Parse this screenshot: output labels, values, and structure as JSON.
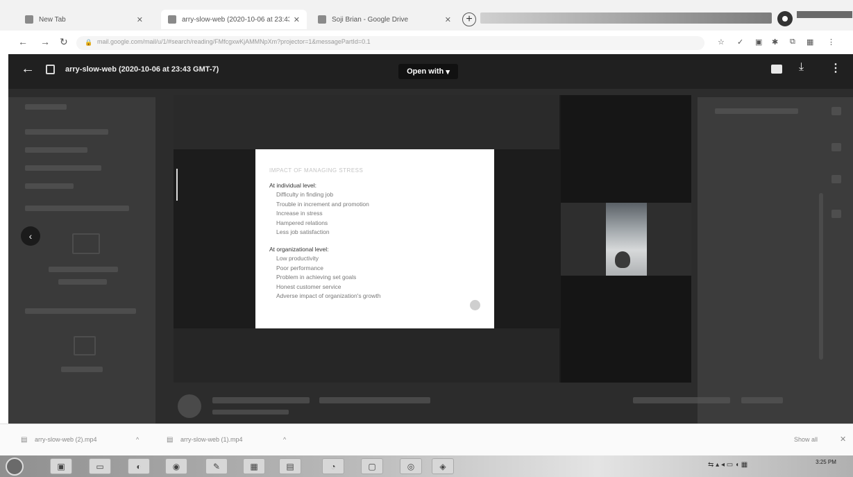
{
  "browser": {
    "tabs": [
      {
        "label": "New Tab",
        "active": false
      },
      {
        "label": "arry-slow-web (2020-10-06 at 23:43 GMT-7)",
        "active": true
      },
      {
        "label": "Soji Brian - Google Drive",
        "active": false
      }
    ],
    "url": "mail.google.com/mail/u/1/#search/reading/FMfcgxwKjAMMNpXm?projector=1&messagePartId=0.1"
  },
  "viewer": {
    "file_title": "arry-slow-web (2020-10-06 at 23:43 GMT-7)",
    "open_with_label": "Open with",
    "open_with_caret": "▾"
  },
  "slide": {
    "title": "IMPACT OF MANAGING STRESS",
    "individual_heading": "At individual level:",
    "individual_items": [
      "Difficulty in finding job",
      "Trouble in increment and promotion",
      "Increase in stress",
      "Hampered relations",
      "Less job satisfaction"
    ],
    "organizational_heading": "At organizational level:",
    "organizational_items": [
      "Low productivity",
      "Poor performance",
      "Problem in achieving set goals",
      "Honest customer service",
      "Adverse impact of organization's growth"
    ]
  },
  "downloads": {
    "items": [
      "arry-slow-web (2).mp4",
      "arry-slow-web (1).mp4"
    ],
    "show_all": "Show all"
  },
  "taskbar": {
    "clock_time": "3:25 PM"
  },
  "colors": {
    "viewer_bg": "#2c2c2c",
    "toolbar_bg": "#202020",
    "slide_bg": "#ffffff"
  }
}
